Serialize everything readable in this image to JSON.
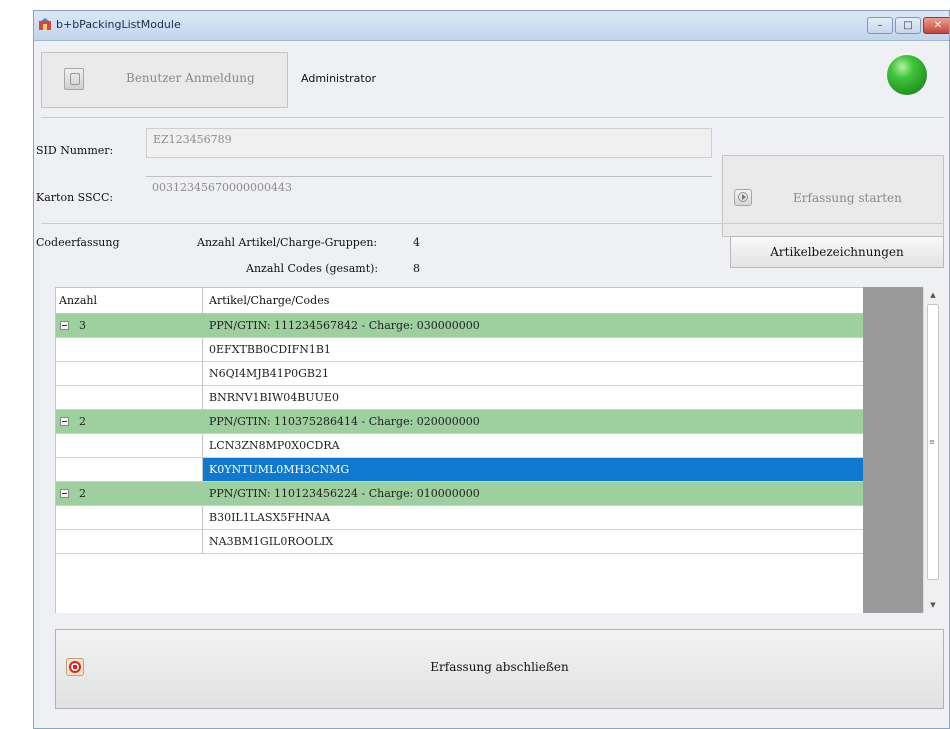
{
  "window": {
    "title": "b+bPackingListModule",
    "icon": "app-icon",
    "buttons": {
      "minimize": "–",
      "maximize": "□",
      "close": "✕"
    }
  },
  "header": {
    "login_label": "Benutzer Anmeldung",
    "user": "Administrator",
    "status_color": "#3fc43a"
  },
  "form": {
    "sid_label": "SID Nummer:",
    "sid_value": "EZ123456789",
    "sscc_label": "Karton SSCC:",
    "sscc_value": "00312345670000000443",
    "start_label": "Erfassung starten"
  },
  "counts": {
    "section_label": "Codeerfassung",
    "groups_label": "Anzahl Artikel/Charge-Gruppen:",
    "groups_value": "4",
    "codes_label": "Anzahl Codes (gesamt):",
    "codes_value": "8",
    "artikel_button": "Artikelbezeichnungen"
  },
  "grid": {
    "columns": [
      "Anzahl",
      "Artikel/Charge/Codes"
    ],
    "rows": [
      {
        "type": "group",
        "count": "3",
        "text": "PPN/GTIN: 111234567842 - Charge: 030000000"
      },
      {
        "type": "code",
        "count": "",
        "text": "0EFXTBB0CDIFN1B1"
      },
      {
        "type": "code",
        "count": "",
        "text": "N6QI4MJB41P0GB21"
      },
      {
        "type": "code",
        "count": "",
        "text": "BNRNV1BIW04BUUE0"
      },
      {
        "type": "group",
        "count": "2",
        "text": "PPN/GTIN: 110375286414 - Charge: 020000000"
      },
      {
        "type": "code",
        "count": "",
        "text": "LCN3ZN8MP0X0CDRA"
      },
      {
        "type": "selected",
        "count": "",
        "text": "K0YNTUML0MH3CNMG"
      },
      {
        "type": "group",
        "count": "2",
        "text": "PPN/GTIN: 110123456224 - Charge: 010000000"
      },
      {
        "type": "code",
        "count": "",
        "text": "B30IL1LASX5FHNAA"
      },
      {
        "type": "code",
        "count": "",
        "text": "NA3BM1GIL0ROOLIX"
      }
    ],
    "colors": {
      "group": "#9ecf9e",
      "selected": "#0f78cf"
    }
  },
  "footer": {
    "finish_label": "Erfassung abschließen"
  }
}
